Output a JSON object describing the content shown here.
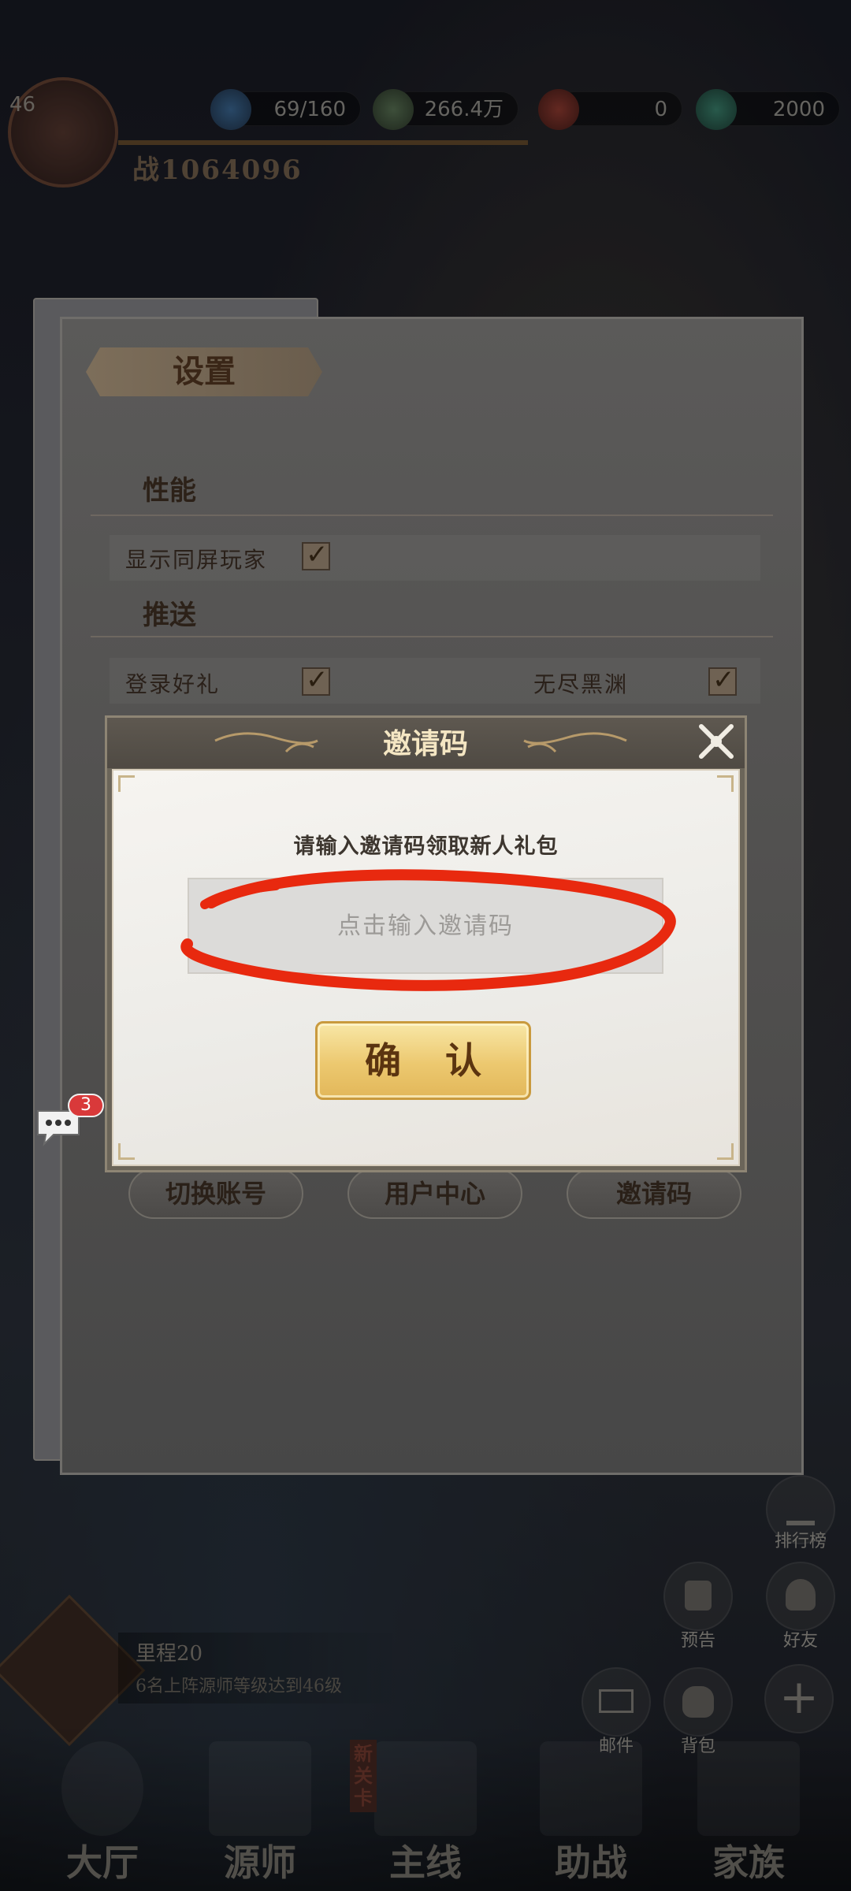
{
  "hud": {
    "level": "46",
    "power": "战1064096",
    "resources": [
      {
        "icon": "stamina-icon",
        "value": "69/160"
      },
      {
        "icon": "coin-icon",
        "value": "266.4万"
      },
      {
        "icon": "ruby-icon",
        "value": "0"
      },
      {
        "icon": "jade-icon",
        "value": "2000"
      }
    ]
  },
  "side_buttons": {
    "rank": "排行榜",
    "notice": "预告",
    "friends": "好友",
    "mail": "邮件",
    "bag": "背包"
  },
  "quest": {
    "title": "里程20",
    "desc": "6名上阵源师等级达到46级"
  },
  "nav": {
    "items": [
      {
        "label": "大厅"
      },
      {
        "label": "源师"
      },
      {
        "label": "主线",
        "badge": "新关卡"
      },
      {
        "label": "助战"
      },
      {
        "label": "家族"
      }
    ]
  },
  "settings": {
    "title": "设置",
    "sections": {
      "performance": "性能",
      "push": "推送"
    },
    "options": {
      "show_players": {
        "label": "显示同屏玩家",
        "checked": true
      },
      "login_gift": {
        "label": "登录好礼",
        "checked": true
      },
      "endless_abyss": {
        "label": "无尽黑渊",
        "checked": true
      }
    },
    "buttons": {
      "switch_account": "切换账号",
      "user_center": "用户中心",
      "invite_code": "邀请码"
    }
  },
  "invite_modal": {
    "title": "邀请码",
    "hint": "请输入邀请码领取新人礼包",
    "input_placeholder": "点击输入邀请码",
    "input_value": "",
    "confirm": "确 认"
  },
  "chat": {
    "unread": "3"
  },
  "colors": {
    "annotation_red": "#e8290f",
    "confirm_gold": "#ecc86f",
    "modal_title": "#f4e6c3"
  }
}
